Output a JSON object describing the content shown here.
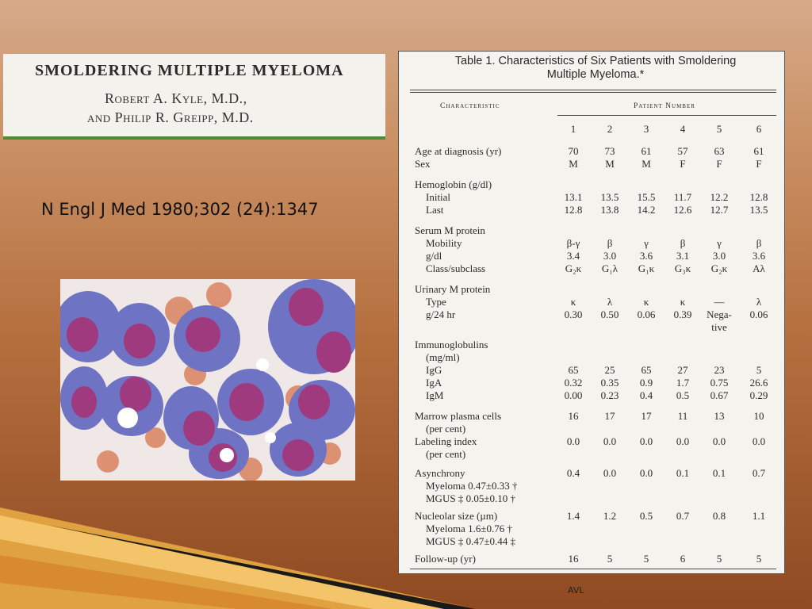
{
  "header_box": {
    "title": "SMOLDERING MULTIPLE MYELOMA",
    "author_line_1": "Robert A. Kyle, M.D.,",
    "author_line_2": "and Philip R. Greipp, M.D."
  },
  "citation": "N Engl J Med 1980;302 (24):1347",
  "footer": "AVL",
  "table": {
    "title_line_1": "Table 1. Characteristics of Six Patients with Smoldering",
    "title_line_2": "Multiple Myeloma.*",
    "col_header_characteristic": "Characteristic",
    "col_header_patient": "Patient Number",
    "patient_numbers": [
      "1",
      "2",
      "3",
      "4",
      "5",
      "6"
    ],
    "rows": [
      {
        "label": "Age at diagnosis (yr)",
        "values": [
          "70",
          "73",
          "61",
          "57",
          "63",
          "61"
        ]
      },
      {
        "label": "Sex",
        "values": [
          "M",
          "M",
          "M",
          "F",
          "F",
          "F"
        ]
      },
      {
        "label": "Hemoglobin (g/dl)",
        "values": []
      },
      {
        "label": "Initial",
        "values": [
          "13.1",
          "13.5",
          "15.5",
          "11.7",
          "12.2",
          "12.8"
        ]
      },
      {
        "label": "Last",
        "values": [
          "12.8",
          "13.8",
          "14.2",
          "12.6",
          "12.7",
          "13.5"
        ]
      },
      {
        "label": "Serum M protein",
        "values": []
      },
      {
        "label": "Mobility",
        "values": [
          "β-γ",
          "β",
          "γ",
          "β",
          "γ",
          "β"
        ]
      },
      {
        "label": "g/dl",
        "values": [
          "3.4",
          "3.0",
          "3.6",
          "3.1",
          "3.0",
          "3.6"
        ]
      },
      {
        "label": "Class/subclass",
        "values": [
          "G₂κ",
          "G₁λ",
          "G₁κ",
          "G₃κ",
          "G₂κ",
          "Aλ"
        ]
      },
      {
        "label": "Urinary M protein",
        "values": []
      },
      {
        "label": "Type",
        "values": [
          "κ",
          "λ",
          "κ",
          "κ",
          "—",
          "λ"
        ]
      },
      {
        "label": "g/24 hr",
        "values": [
          "0.30",
          "0.50",
          "0.06",
          "0.39",
          "Nega-",
          "0.06"
        ]
      },
      {
        "label": "",
        "values": [
          "",
          "",
          "",
          "",
          "tive",
          ""
        ]
      },
      {
        "label": "Immunoglobulins",
        "values": []
      },
      {
        "label": "(mg/ml)",
        "values": []
      },
      {
        "label": "IgG",
        "values": [
          "65",
          "25",
          "65",
          "27",
          "23",
          "5"
        ]
      },
      {
        "label": "IgA",
        "values": [
          "0.32",
          "0.35",
          "0.9",
          "1.7",
          "0.75",
          "26.6"
        ]
      },
      {
        "label": "IgM",
        "values": [
          "0.00",
          "0.23",
          "0.4",
          "0.5",
          "0.67",
          "0.29"
        ]
      },
      {
        "label": "Marrow plasma cells",
        "values": [
          "16",
          "17",
          "17",
          "11",
          "13",
          "10"
        ]
      },
      {
        "label": "(per cent)",
        "values": []
      },
      {
        "label": "Labeling index",
        "values": [
          "0.0",
          "0.0",
          "0.0",
          "0.0",
          "0.0",
          "0.0"
        ]
      },
      {
        "label": "(per cent)",
        "values": []
      },
      {
        "label": "Asynchrony",
        "values": [
          "0.4",
          "0.0",
          "0.0",
          "0.1",
          "0.1",
          "0.7"
        ]
      },
      {
        "label": "Myeloma 0.47±0.33 †",
        "values": []
      },
      {
        "label": "MGUS ‡ 0.05±0.10 †",
        "values": []
      },
      {
        "label": "Nucleolar size (µm)",
        "values": [
          "1.4",
          "1.2",
          "0.5",
          "0.7",
          "0.8",
          "1.1"
        ]
      },
      {
        "label": "Myeloma 1.6±0.76 †",
        "values": []
      },
      {
        "label": "MGUS ‡ 0.47±0.44 ‡",
        "values": []
      },
      {
        "label": "Follow-up (yr)",
        "values": [
          "16",
          "5",
          "5",
          "6",
          "5",
          "5"
        ]
      }
    ]
  }
}
